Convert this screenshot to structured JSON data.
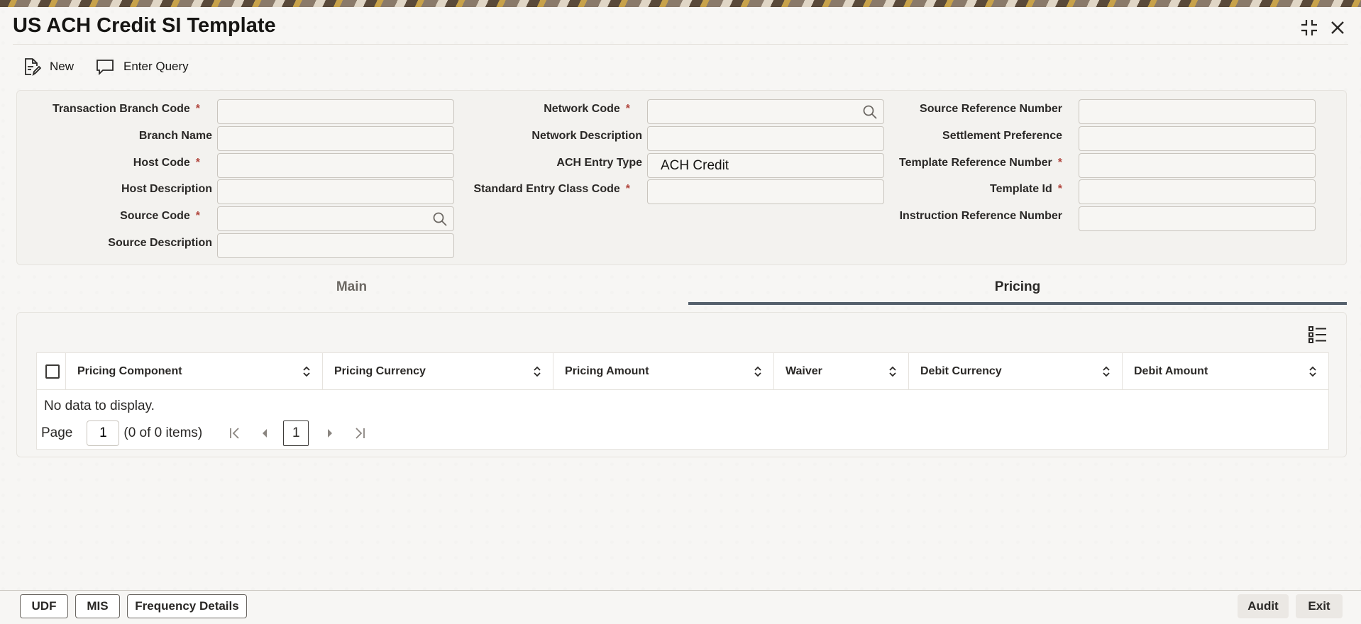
{
  "window": {
    "title": "US ACH Credit SI Template",
    "collapse_icon": "collapse-icon",
    "close_icon": "close-icon"
  },
  "toolbar": {
    "new_label": "New",
    "enter_query_label": "Enter Query"
  },
  "form": {
    "col1": [
      {
        "label": "Transaction Branch Code",
        "required": true,
        "value": ""
      },
      {
        "label": "Branch Name",
        "required": false,
        "value": ""
      },
      {
        "label": "Host Code",
        "required": true,
        "value": ""
      },
      {
        "label": "Host Description",
        "required": false,
        "value": ""
      },
      {
        "label": "Source Code",
        "required": true,
        "value": "",
        "search": true
      },
      {
        "label": "Source Description",
        "required": false,
        "value": ""
      }
    ],
    "col2": [
      {
        "label": "Network Code",
        "required": true,
        "value": "",
        "search": true
      },
      {
        "label": "Network Description",
        "required": false,
        "value": ""
      },
      {
        "label": "ACH Entry Type",
        "required": false,
        "value": "ACH Credit"
      },
      {
        "label": "Standard Entry Class Code",
        "required": true,
        "value": ""
      }
    ],
    "col3": [
      {
        "label": "Source Reference Number",
        "required": false,
        "value": ""
      },
      {
        "label": "Settlement Preference",
        "required": false,
        "value": ""
      },
      {
        "label": "Template Reference Number",
        "required": true,
        "value": ""
      },
      {
        "label": "Template Id",
        "required": true,
        "value": ""
      },
      {
        "label": "Instruction Reference Number",
        "required": false,
        "value": ""
      }
    ],
    "required_mark": "*"
  },
  "tabs": [
    {
      "label": "Main",
      "active": false
    },
    {
      "label": "Pricing",
      "active": true
    }
  ],
  "pricing_table": {
    "columns": [
      "Pricing Component",
      "Pricing Currency",
      "Pricing Amount",
      "Waiver",
      "Debit Currency",
      "Debit Amount"
    ],
    "empty_message": "No data to display.",
    "pager": {
      "page_label": "Page",
      "page_value": "1",
      "items_summary": "(0 of 0 items)",
      "current_page": "1"
    }
  },
  "footer": {
    "udf_label": "UDF",
    "mis_label": "MIS",
    "frequency_label": "Frequency Details",
    "audit_label": "Audit",
    "exit_label": "Exit"
  },
  "colors": {
    "accent_tab": "#55606c",
    "required": "#b0433a"
  }
}
